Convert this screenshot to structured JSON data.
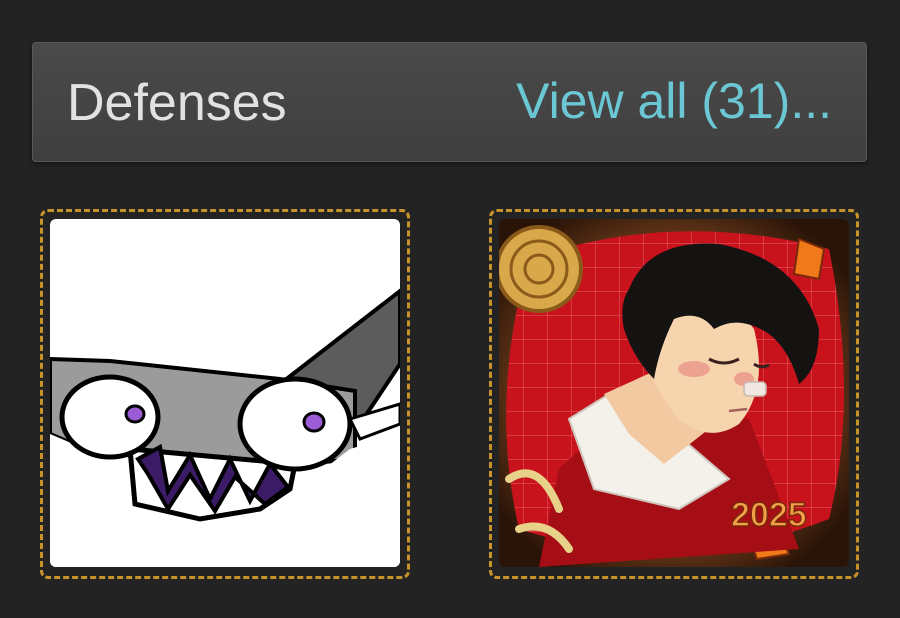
{
  "section": {
    "title": "Defenses",
    "view_all_label": "View all (31)..."
  },
  "thumbnails": [
    {
      "icon": "shark-monster-drawing-icon"
    },
    {
      "icon": "portrait-artwork-icon",
      "badge_text": "2025"
    }
  ],
  "colors": {
    "background": "#232323",
    "header": "#444444",
    "title_text": "#e2e2e2",
    "link_text": "#6cc7d4",
    "thumb_border": "#c8922a"
  }
}
